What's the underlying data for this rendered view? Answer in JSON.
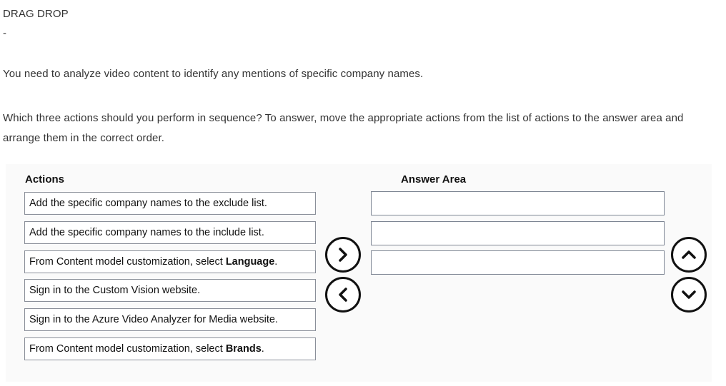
{
  "question": {
    "type_label": "DRAG DROP",
    "dash": "-",
    "scenario": "You need to analyze video content to identify any mentions of specific company names.",
    "instruction": "Which three actions should you perform in sequence? To answer, move the appropriate actions from the list of actions to the answer area and arrange them in the correct order."
  },
  "actions_heading": "Actions",
  "answer_heading": "Answer Area",
  "actions": [
    {
      "text": "Add the specific company names to the exclude list.",
      "bold": ""
    },
    {
      "text": "Add the specific company names to the include list.",
      "bold": ""
    },
    {
      "text": "From Content model customization, select ",
      "bold": "Language",
      "suffix": "."
    },
    {
      "text": "Sign in to the Custom Vision website.",
      "bold": ""
    },
    {
      "text": "Sign in to the Azure Video Analyzer for Media website.",
      "bold": ""
    },
    {
      "text": "From Content model customization, select ",
      "bold": "Brands",
      "suffix": "."
    }
  ],
  "answer_slots": [
    "",
    "",
    ""
  ],
  "controls": {
    "move_right_icon": "chevron-right-icon",
    "move_left_icon": "chevron-left-icon",
    "move_up_icon": "chevron-up-icon",
    "move_down_icon": "chevron-down-icon"
  }
}
